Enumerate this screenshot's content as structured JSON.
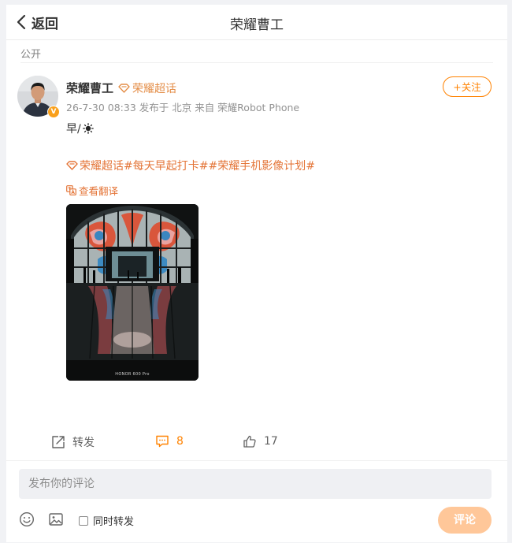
{
  "header": {
    "back_label": "返回",
    "title": "荣耀曹工"
  },
  "visibility": "公开",
  "post": {
    "author": "荣耀曹工",
    "super_topic_badge": "荣耀超话",
    "meta": "26-7-30 08:33 发布于 北京 来自 荣耀Robot Phone",
    "follow_label": "+关注",
    "text": "早/",
    "topics": [
      "荣耀超话",
      "#每天早起打卡#",
      "#荣耀手机影像计划#"
    ],
    "translate_label": "查看翻译",
    "photo_caption": "HONOR 600 Pro",
    "accent_color": "#ff8200"
  },
  "actions": {
    "repost_label": "转发",
    "comment_count": "8",
    "like_count": "17"
  },
  "comment_box": {
    "placeholder": "发布你的评论",
    "repost_checkbox_label": "同时转发",
    "submit_label": "评论"
  }
}
